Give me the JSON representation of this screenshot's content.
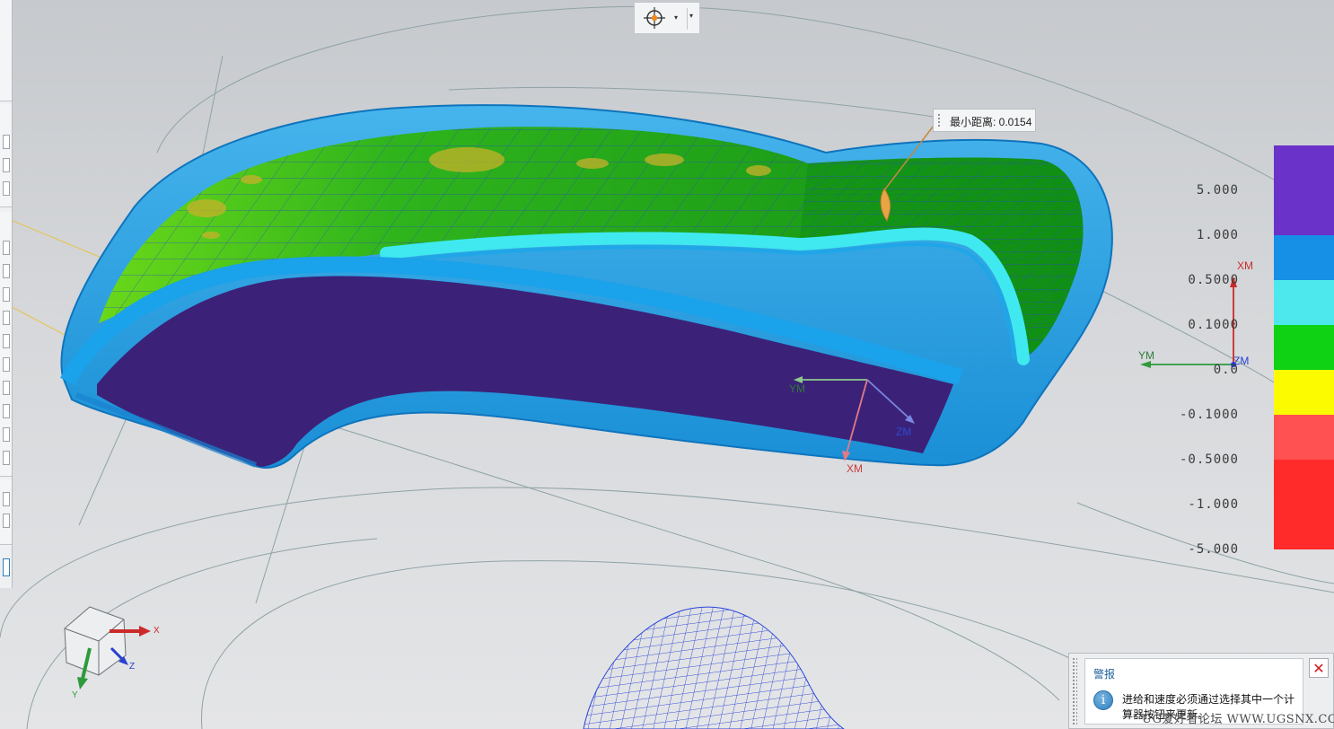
{
  "toolbar": {
    "snap_icon": "snap-point-icon",
    "dropdown_glyph": "▾"
  },
  "tooltip": {
    "min_distance": "最小距离: 0.0154"
  },
  "legend": {
    "labels": [
      "5.000",
      "1.000",
      "0.5000",
      "0.1000",
      "0.0",
      "-0.1000",
      "-0.5000",
      "-1.000",
      "-5.000"
    ],
    "colors": [
      "#6a32c8",
      "#1590e6",
      "#4de8ee",
      "#10d214",
      "#fdfb00",
      "#ff5151",
      "#ff2a2a"
    ]
  },
  "csys": {
    "tool": {
      "x": "XM",
      "y": "YM",
      "z": "ZM"
    },
    "legend_axes": {
      "x": "XM",
      "y": "YM",
      "z": "ZM"
    },
    "view_triad": {
      "x": "X",
      "y": "Y",
      "z": "Z"
    }
  },
  "colors": {
    "axis_x": "#cc2a2a",
    "axis_y": "#2e9a3a",
    "axis_z": "#2840d0"
  },
  "alert": {
    "title": "警报",
    "message": "进给和速度必须通过选择其中一个计算器按钮来更新。",
    "close_glyph": "✕",
    "info_glyph": "i"
  },
  "watermark": "UG爱好者论坛 WWW.UGSNX.COM"
}
